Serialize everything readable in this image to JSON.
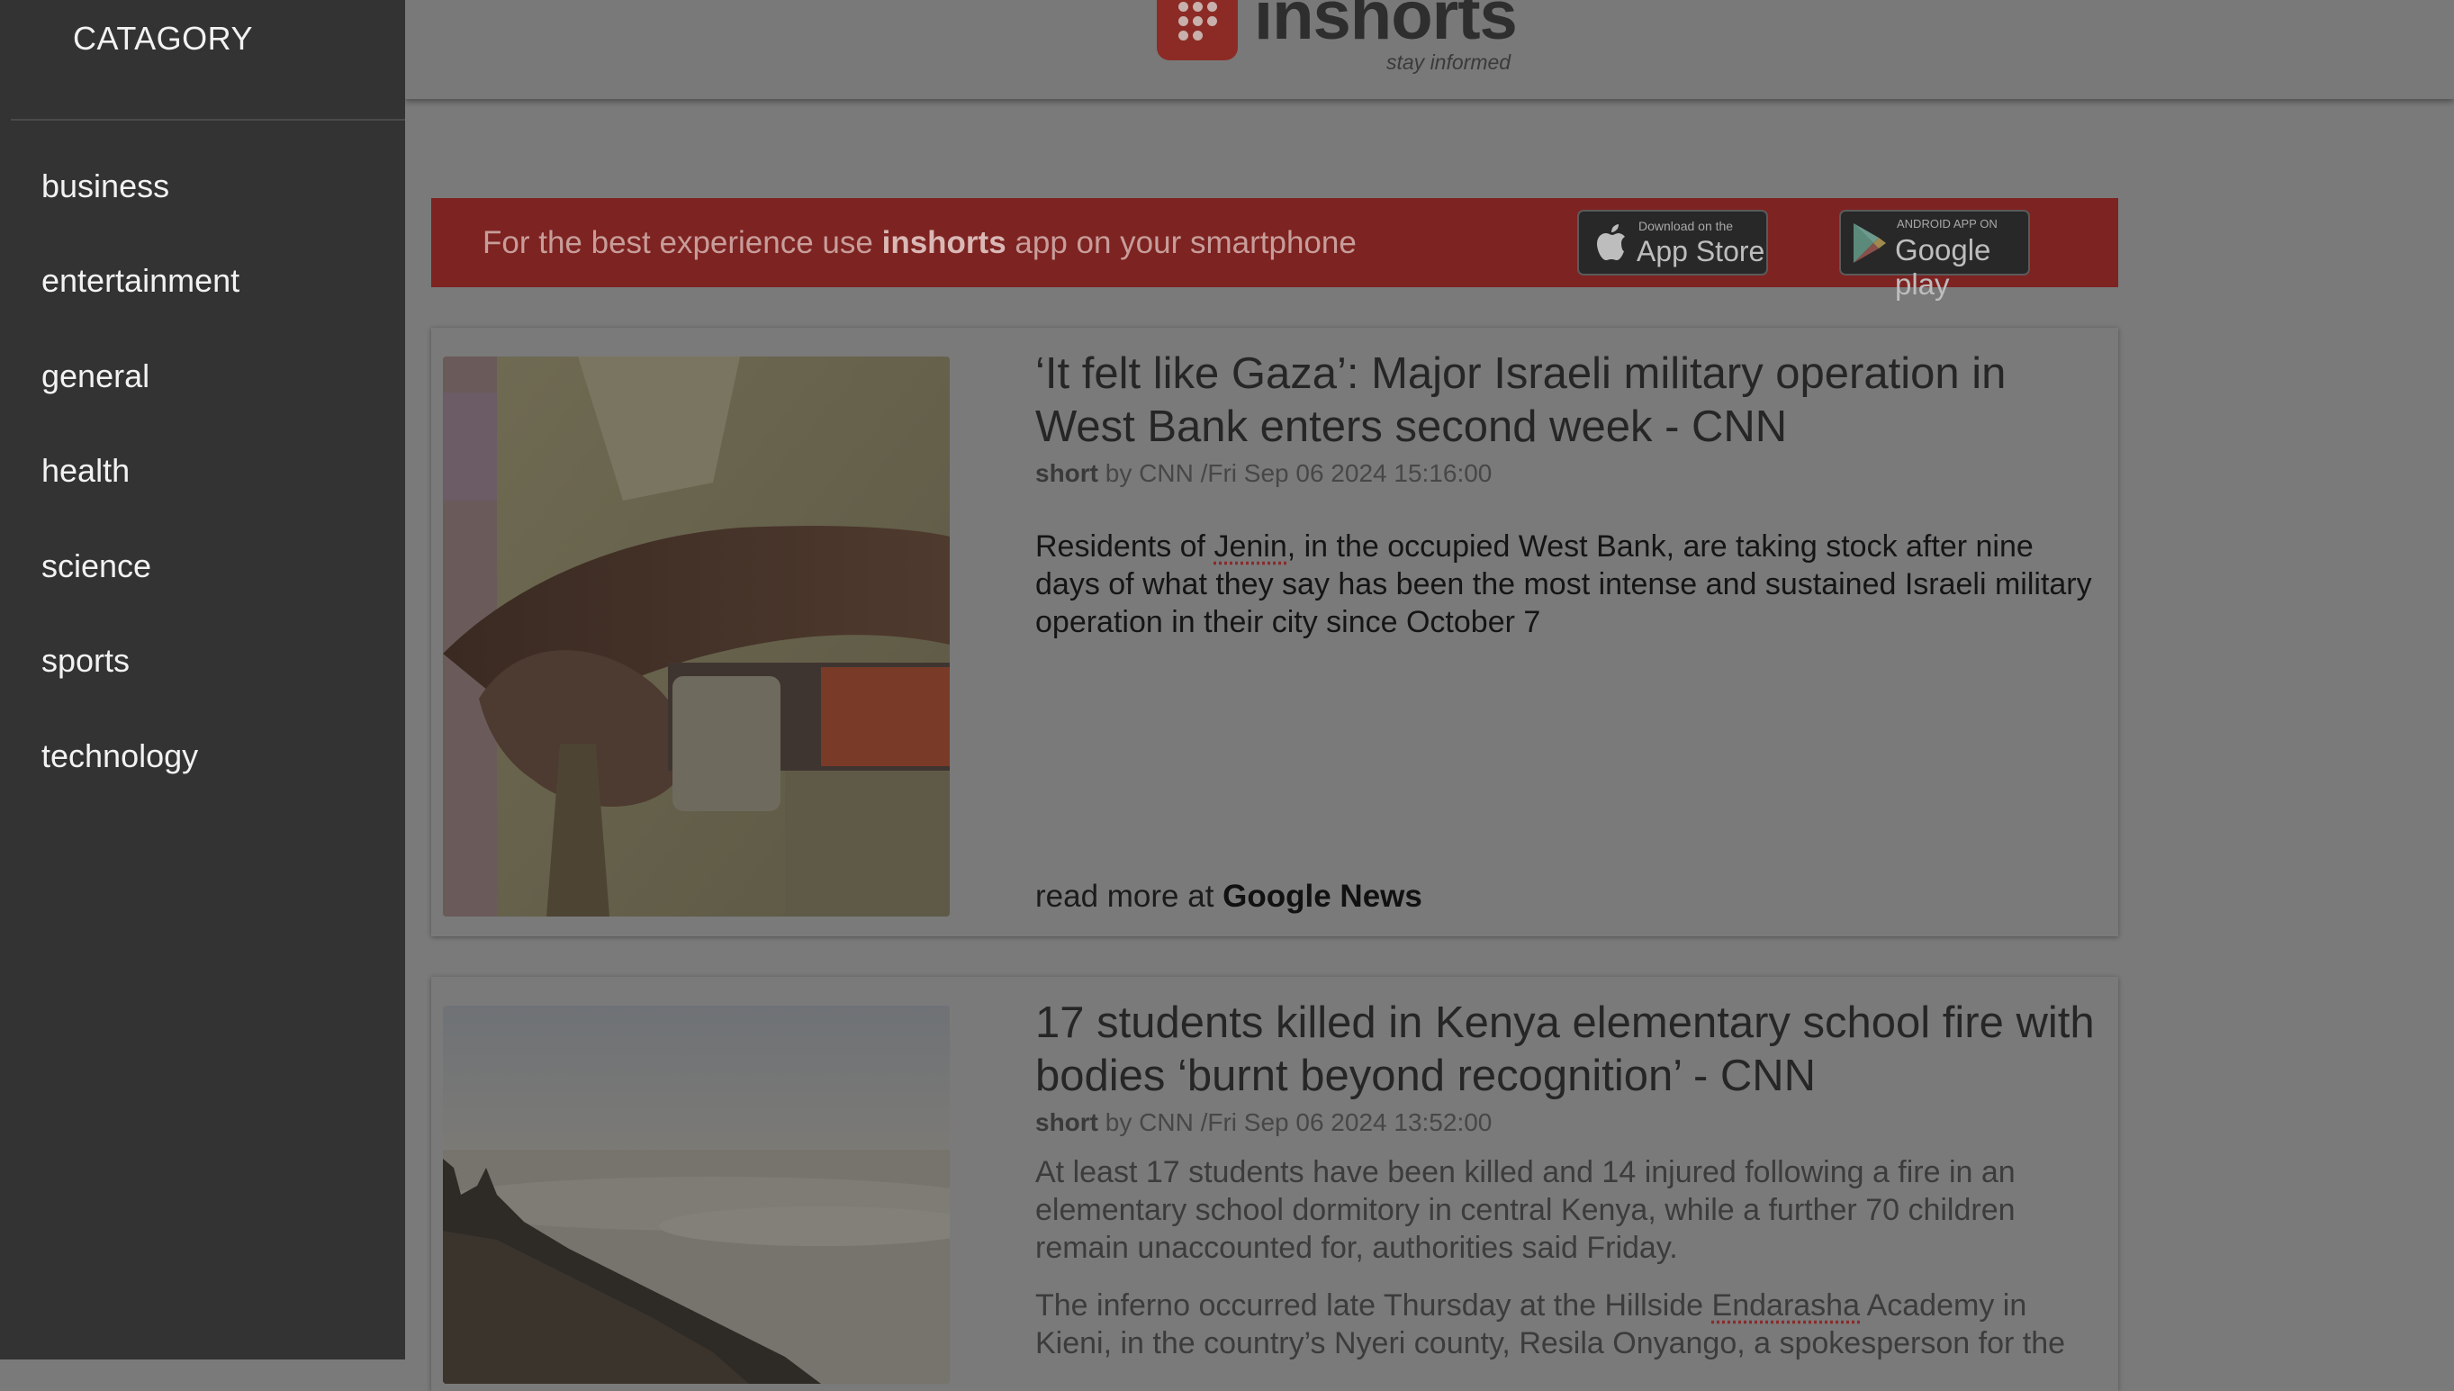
{
  "sidebar": {
    "title": "CATAGORY",
    "items": [
      {
        "label": "business"
      },
      {
        "label": "entertainment"
      },
      {
        "label": "general"
      },
      {
        "label": "health"
      },
      {
        "label": "science"
      },
      {
        "label": "sports"
      },
      {
        "label": "technology"
      }
    ]
  },
  "header": {
    "logo_text": "inshorts",
    "tagline": "stay informed"
  },
  "promo": {
    "prefix": "For the best experience use ",
    "brand": "inshorts",
    "suffix": " app on your smartphone",
    "appstore": {
      "small": "Download on the",
      "big": "App Store"
    },
    "googleplay": {
      "small": "ANDROID APP ON",
      "big": "Google play"
    }
  },
  "articles": [
    {
      "title": "‘It felt like Gaza’: Major Israeli military operation in West Bank enters second week - CNN",
      "meta_short": "short",
      "meta_rest": " by CNN /Fri Sep 06 2024 15:16:00",
      "body_pre": "Residents of ",
      "body_word": "Jenin",
      "body_post": ", in the occupied West Bank, are taking stock after nine days of what they say has been the most intense and sustained Israeli military operation in their city since October 7",
      "read_more_prefix": "read more at ",
      "read_more_source": "Google News"
    },
    {
      "title": "17 students killed in Kenya elementary school fire with bodies ‘burnt beyond recognition’ - CNN",
      "meta_short": "short",
      "meta_rest": " by CNN /Fri Sep 06 2024 13:52:00",
      "body": "At least 17 students have been killed and 14 injured following a fire in an elementary school dormitory in central Kenya, while a further 70 children remain unaccounted for, authorities said Friday.",
      "body2_pre": "The inferno occurred late Thursday at the Hillside ",
      "body2_word": "Endarasha",
      "body2_post": " Academy in Kieni, in the country’s Nyeri county, Resila Onyango, a spokesperson for the"
    }
  ]
}
